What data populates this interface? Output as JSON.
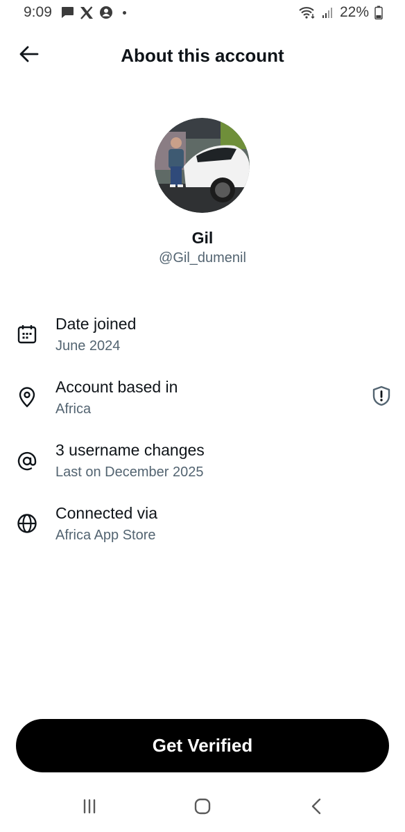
{
  "status_bar": {
    "time": "9:09",
    "battery": "22%",
    "icons": [
      "message-icon",
      "x-logo-icon",
      "account-circle-icon",
      "wifi-icon",
      "signal-icon",
      "battery-icon"
    ]
  },
  "header": {
    "title": "About this account",
    "back_icon": "arrow-left-icon"
  },
  "profile": {
    "name": "Gil",
    "handle": "@Gil_dumenil"
  },
  "info": [
    {
      "icon": "calendar-icon",
      "title": "Date joined",
      "subtitle": "June 2024"
    },
    {
      "icon": "location-pin-icon",
      "title": "Account based in",
      "subtitle": "Africa",
      "trailing_icon": "shield-alert-icon"
    },
    {
      "icon": "at-sign-icon",
      "title": "3 username changes",
      "subtitle": "Last on December 2025"
    },
    {
      "icon": "globe-icon",
      "title": "Connected via",
      "subtitle": "Africa App Store"
    }
  ],
  "cta": {
    "label": "Get Verified"
  },
  "nav_bar": {
    "icons": [
      "recent-apps-icon",
      "home-icon",
      "back-icon"
    ]
  },
  "colors": {
    "text_primary": "#0f1419",
    "text_secondary": "#536471",
    "button_bg": "#000000",
    "button_text": "#ffffff",
    "background": "#ffffff"
  }
}
